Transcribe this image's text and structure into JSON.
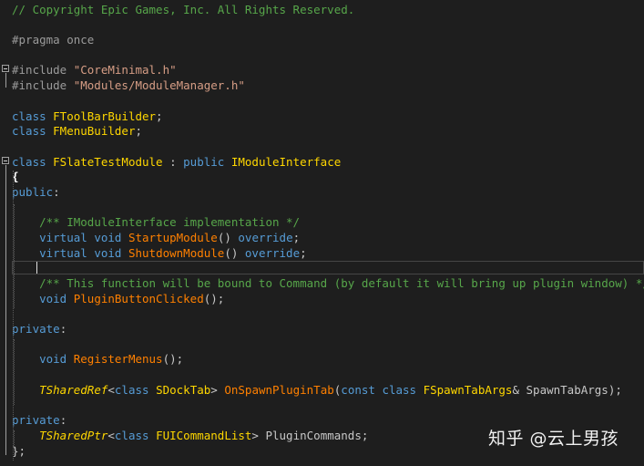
{
  "code_lines": [
    [
      {
        "t": "// Copyright Epic Games, Inc. All Rights Reserved.",
        "c": "comment"
      }
    ],
    [],
    [
      {
        "t": "#pragma once",
        "c": "pre"
      }
    ],
    [],
    [
      {
        "t": "#include ",
        "c": "pre"
      },
      {
        "t": "\"CoreMinimal.h\"",
        "c": "str"
      }
    ],
    [
      {
        "t": "#include ",
        "c": "pre"
      },
      {
        "t": "\"Modules/ModuleManager.h\"",
        "c": "str"
      }
    ],
    [],
    [
      {
        "t": "class ",
        "c": "kw"
      },
      {
        "t": "FToolBarBuilder",
        "c": "type"
      },
      {
        "t": ";",
        "c": "txt"
      }
    ],
    [
      {
        "t": "class ",
        "c": "kw"
      },
      {
        "t": "FMenuBuilder",
        "c": "type"
      },
      {
        "t": ";",
        "c": "txt"
      }
    ],
    [],
    [
      {
        "t": "class ",
        "c": "kw"
      },
      {
        "t": "FSlateTestModule",
        "c": "type"
      },
      {
        "t": " : ",
        "c": "txt"
      },
      {
        "t": "public ",
        "c": "kw"
      },
      {
        "t": "IModuleInterface",
        "c": "type"
      }
    ],
    [
      {
        "t": "{",
        "c": "brace"
      }
    ],
    [
      {
        "t": "public",
        "c": "kw"
      },
      {
        "t": ":",
        "c": "txt"
      }
    ],
    [],
    [
      {
        "t": "    ",
        "c": "txt"
      },
      {
        "t": "/** IModuleInterface implementation */",
        "c": "comment"
      }
    ],
    [
      {
        "t": "    ",
        "c": "txt"
      },
      {
        "t": "virtual ",
        "c": "kw"
      },
      {
        "t": "void ",
        "c": "kw"
      },
      {
        "t": "StartupModule",
        "c": "fn"
      },
      {
        "t": "() ",
        "c": "txt"
      },
      {
        "t": "override",
        "c": "kw"
      },
      {
        "t": ";",
        "c": "txt"
      }
    ],
    [
      {
        "t": "    ",
        "c": "txt"
      },
      {
        "t": "virtual ",
        "c": "kw"
      },
      {
        "t": "void ",
        "c": "kw"
      },
      {
        "t": "ShutdownModule",
        "c": "fn"
      },
      {
        "t": "() ",
        "c": "txt"
      },
      {
        "t": "override",
        "c": "kw"
      },
      {
        "t": ";",
        "c": "txt"
      }
    ],
    [],
    [
      {
        "t": "    ",
        "c": "txt"
      },
      {
        "t": "/** This function will be bound to Command (by default it will bring up plugin window) */",
        "c": "comment"
      }
    ],
    [
      {
        "t": "    ",
        "c": "txt"
      },
      {
        "t": "void ",
        "c": "kw"
      },
      {
        "t": "PluginButtonClicked",
        "c": "fn"
      },
      {
        "t": "();",
        "c": "txt"
      }
    ],
    [],
    [
      {
        "t": "private",
        "c": "kw"
      },
      {
        "t": ":",
        "c": "txt"
      }
    ],
    [],
    [
      {
        "t": "    ",
        "c": "txt"
      },
      {
        "t": "void ",
        "c": "kw"
      },
      {
        "t": "RegisterMenus",
        "c": "fn"
      },
      {
        "t": "();",
        "c": "txt"
      }
    ],
    [],
    [
      {
        "t": "    ",
        "c": "txt"
      },
      {
        "t": "TSharedRef",
        "c": "itype"
      },
      {
        "t": "<",
        "c": "txt"
      },
      {
        "t": "class ",
        "c": "kw"
      },
      {
        "t": "SDockTab",
        "c": "type"
      },
      {
        "t": "> ",
        "c": "txt"
      },
      {
        "t": "OnSpawnPluginTab",
        "c": "fn"
      },
      {
        "t": "(",
        "c": "txt"
      },
      {
        "t": "const ",
        "c": "kw"
      },
      {
        "t": "class ",
        "c": "kw"
      },
      {
        "t": "FSpawnTabArgs",
        "c": "type"
      },
      {
        "t": "& ",
        "c": "txt"
      },
      {
        "t": "SpawnTabArgs",
        "c": "txt"
      },
      {
        "t": ");",
        "c": "txt"
      }
    ],
    [],
    [
      {
        "t": "private",
        "c": "kw"
      },
      {
        "t": ":",
        "c": "txt"
      }
    ],
    [
      {
        "t": "    ",
        "c": "txt"
      },
      {
        "t": "TSharedPtr",
        "c": "itype"
      },
      {
        "t": "<",
        "c": "txt"
      },
      {
        "t": "class ",
        "c": "kw"
      },
      {
        "t": "FUICommandList",
        "c": "type"
      },
      {
        "t": "> ",
        "c": "txt"
      },
      {
        "t": "PluginCommands",
        "c": "txt"
      },
      {
        "t": ";",
        "c": "txt"
      }
    ],
    [
      {
        "t": "};",
        "c": "txt"
      }
    ]
  ],
  "watermark": "知乎 @云上男孩",
  "colors": {
    "background": "#1e1e1e",
    "comment": "#57a64a",
    "keyword": "#569cd6",
    "type": "#ffd700",
    "function": "#ff8000",
    "string": "#d69d85",
    "text": "#c8c8c8"
  }
}
